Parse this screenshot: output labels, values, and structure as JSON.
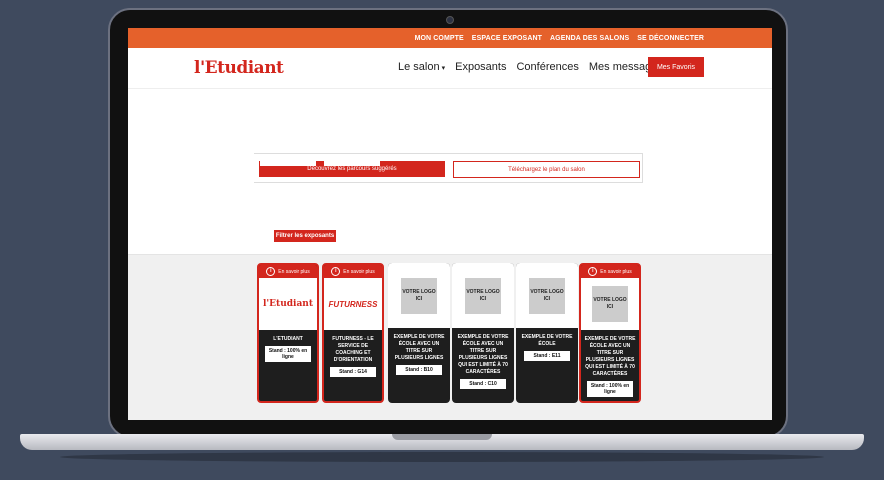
{
  "topbar": {
    "links": [
      "MON COMPTE",
      "ESPACE EXPOSANT",
      "AGENDA DES SALONS",
      "SE DÉCONNECTER"
    ]
  },
  "header": {
    "logo": "l'Etudiant",
    "nav": [
      "Le salon",
      "Exposants",
      "Conférences",
      "Mes messages"
    ],
    "favorites_label": "Mes Favoris"
  },
  "actions": {
    "suggested": "Découvrez les parcours suggérés",
    "download_plan": "Téléchargez le plan du salon",
    "filter": "Filtrer les exposants"
  },
  "colors": {
    "accent": "#d3261d",
    "topbar": "#e5612b"
  },
  "exhibitors": [
    {
      "featured": true,
      "head": "En savoir plus",
      "logo": "l'Etudiant",
      "title": "L'ETUDIANT",
      "stand": "Stand : 100% en ligne"
    },
    {
      "featured": true,
      "head": "En savoir plus",
      "logo": "FUTURNESS",
      "title": "FUTURNESS - LE SERVICE DE COACHING ET D'ORIENTATION",
      "stand": "Stand : G14"
    },
    {
      "featured": false,
      "logo": "VOTRE LOGO ICI",
      "title": "EXEMPLE DE VOTRE ÉCOLE AVEC UN TITRE SUR PLUSIEURS LIGNES",
      "stand": "Stand : B10"
    },
    {
      "featured": false,
      "logo": "VOTRE LOGO ICI",
      "title": "EXEMPLE DE VOTRE ÉCOLE AVEC UN TITRE SUR PLUSIEURS LIGNES QUI EST LIMITÉ À 70 CARACTÈRES",
      "stand": "Stand : C10"
    },
    {
      "featured": false,
      "logo": "VOTRE LOGO ICI",
      "title": "EXEMPLE DE VOTRE ÉCOLE",
      "stand": "Stand : E11"
    },
    {
      "featured": true,
      "head": "En savoir plus",
      "logo": "VOTRE LOGO ICI",
      "title": "EXEMPLE DE VOTRE ÉCOLE AVEC UN TITRE SUR PLUSIEURS LIGNES QUI EST LIMITÉ À 70 CARACTÈRES",
      "stand": "Stand : 100% en ligne"
    }
  ]
}
